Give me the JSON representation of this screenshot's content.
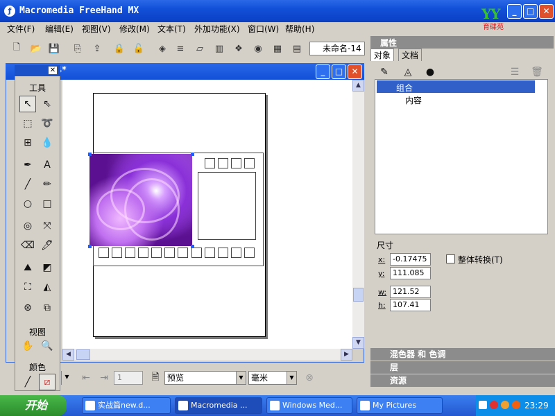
{
  "app": {
    "title": "Macromedia FreeHand MX"
  },
  "watermark": {
    "top": "YY",
    "bottom": "育碟苑"
  },
  "menu": [
    "文件(F)",
    "编辑(E)",
    "视图(V)",
    "修改(M)",
    "文本(T)",
    "外加功能(X)",
    "窗口(W)",
    "帮助(H)"
  ],
  "toolbar": {
    "doc_name": "未命名-14"
  },
  "document": {
    "title": "4*"
  },
  "tools_panel": {
    "title_tools": "工具",
    "title_view": "视图",
    "title_color": "颜色"
  },
  "status": {
    "preview": "预览",
    "units": "毫米",
    "page": "1"
  },
  "properties": {
    "title": "属性",
    "tab_object": "对象",
    "tab_document": "文档",
    "tree_group": "组合",
    "tree_content": "内容",
    "size_label": "尺寸",
    "x_label": "x:",
    "x_value": "-0.17475",
    "y_label": "y:",
    "y_value": "111.085",
    "w_label": "w:",
    "w_value": "121.52",
    "h_label": "h:",
    "h_value": "107.41",
    "transform_label": "整体转换(T)",
    "sect_mixer": "混色器 和 色调",
    "sect_layers": "层",
    "sect_assets": "资源"
  },
  "taskbar": {
    "start": "开始",
    "tasks": [
      "实战篇new.d...",
      "Macromedia ...",
      "Windows Med...",
      "My Pictures"
    ],
    "clock": "23:29"
  },
  "colors": {
    "titlebar": "#1250d8",
    "selection": "#3060c8",
    "image": "#7020c0"
  }
}
